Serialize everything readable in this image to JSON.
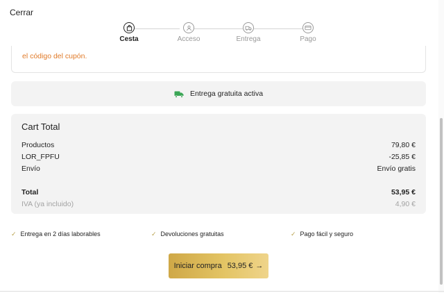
{
  "header": {
    "close_label": "Cerrar"
  },
  "steps": [
    {
      "label": "Cesta",
      "icon": "bag-icon",
      "active": true
    },
    {
      "label": "Acceso",
      "icon": "user-icon",
      "active": false
    },
    {
      "label": "Entrega",
      "icon": "truck-icon",
      "active": false
    },
    {
      "label": "Pago",
      "icon": "card-icon",
      "active": false
    }
  ],
  "coupon": {
    "text": "el código del cupón."
  },
  "shipping_banner": {
    "text": "Entrega gratuita activa",
    "icon": "truck-icon",
    "icon_color": "#3aa655"
  },
  "cart": {
    "title": "Cart Total",
    "rows": [
      {
        "label": "Productos",
        "value": "79,80 €"
      },
      {
        "label": "LOR_FPFU",
        "value": "-25,85 €"
      },
      {
        "label": "Envío",
        "value": "Envío gratis"
      }
    ],
    "total": {
      "label": "Total",
      "value": "53,95 €"
    },
    "vat": {
      "label": "IVA (ya incluido)",
      "value": "4,90 €"
    }
  },
  "features": [
    "Entrega en 2 días laborables",
    "Devoluciones gratuitas",
    "Pago fácil y seguro"
  ],
  "cta": {
    "label": "Iniciar compra",
    "amount": "53,95 €",
    "arrow": "→",
    "color": "#d9b451"
  }
}
